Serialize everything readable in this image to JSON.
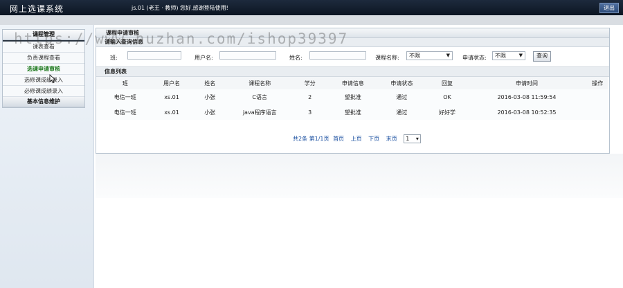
{
  "header": {
    "app_title": "网上选课系统",
    "welcome": "js.01 (老王 · 教师)   您好,感谢登陆使用!",
    "logout_label": "退出"
  },
  "sidebar": {
    "groups": [
      {
        "title": "课程管理",
        "items": [
          {
            "label": "课表查看"
          },
          {
            "label": "负责课程查看"
          },
          {
            "label": "选课申请审核",
            "active": true
          },
          {
            "label": "选修课成绩录入"
          },
          {
            "label": "必修课成绩录入"
          }
        ]
      },
      {
        "title": "基本信息维护",
        "items": []
      }
    ]
  },
  "main": {
    "panel_title": "课程申请审核",
    "query": {
      "heading": "请输入查询信息",
      "class_label": "班:",
      "class_value": "",
      "username_label": "用户名:",
      "username_value": "",
      "name_label": "姓名:",
      "name_value": "",
      "course_label": "课程名称:",
      "course_value": "不限",
      "status_label": "申请状态:",
      "status_value": "不限",
      "search_label": "查询"
    },
    "list": {
      "heading": "信息列表",
      "columns": [
        "班",
        "用户名",
        "姓名",
        "课程名称",
        "学分",
        "申请信息",
        "申请状态",
        "回复",
        "申请时间",
        "操作"
      ],
      "rows": [
        [
          "电信一班",
          "xs.01",
          "小张",
          "C语言",
          "2",
          "望批准",
          "通过",
          "OK",
          "2016-03-08 11:59:54",
          ""
        ],
        [
          "电信一班",
          "xs.01",
          "小张",
          "java程序语言",
          "3",
          "望批准",
          "通过",
          "好好学",
          "2016-03-08 10:52:35",
          ""
        ]
      ]
    },
    "pager": {
      "summary": "共2条 第1/1页",
      "first": "首页",
      "prev": "上页",
      "next": "下页",
      "last": "末页",
      "page_select": "1"
    }
  },
  "watermark": "https://www.huzhan.com/ishop39397",
  "colors": {
    "header_bg": "#0c1522",
    "active_menu": "#1f7a1f",
    "link": "#1a4fa0"
  }
}
